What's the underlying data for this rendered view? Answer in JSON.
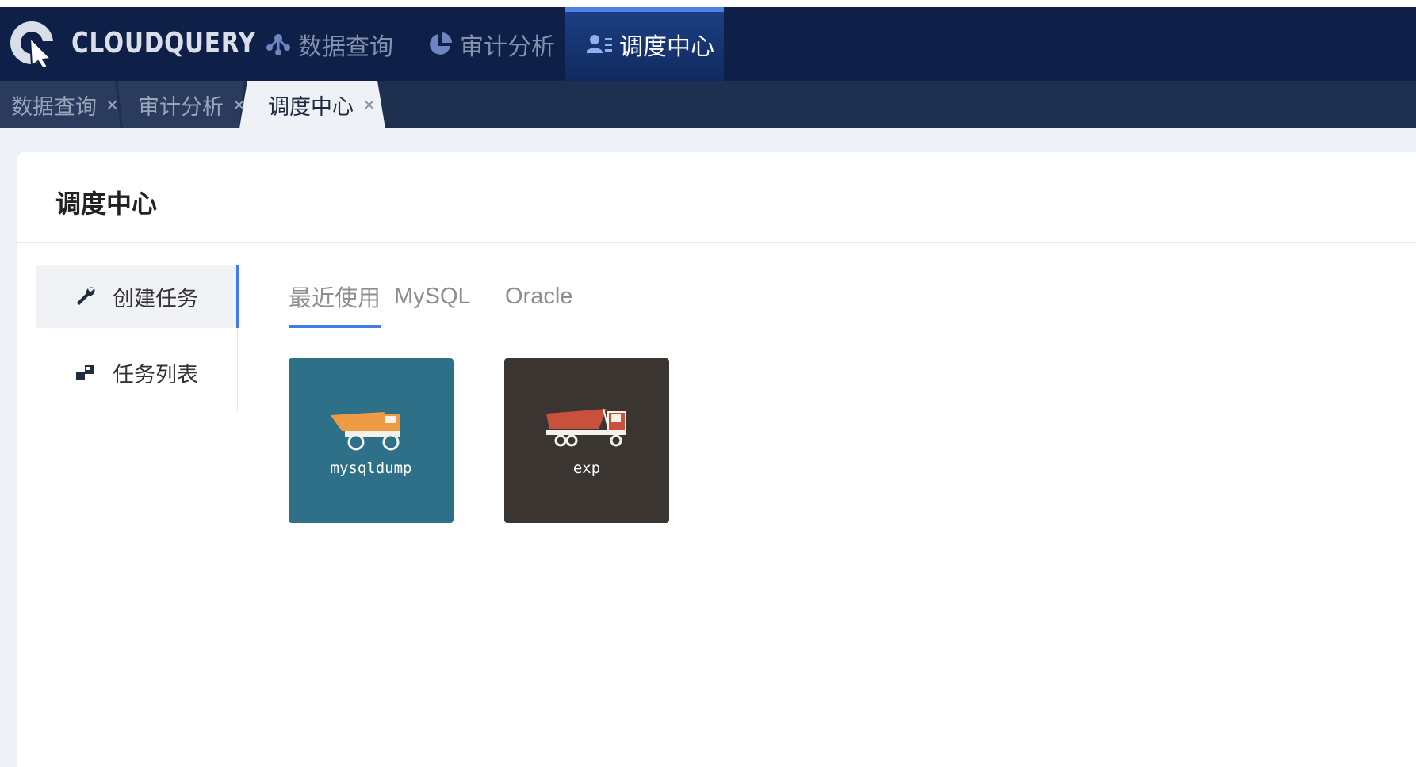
{
  "app": {
    "brand": "CLOUDQUERY"
  },
  "nav": {
    "items": [
      {
        "label": "数据查询",
        "icon": "share-nodes-icon"
      },
      {
        "label": "审计分析",
        "icon": "pie-chart-icon"
      },
      {
        "label": "调度中心",
        "icon": "user-list-icon",
        "active": true
      }
    ]
  },
  "tabs": [
    {
      "label": "数据查询",
      "close": "×"
    },
    {
      "label": "审计分析",
      "close": "×"
    },
    {
      "label": "调度中心",
      "close": "×",
      "active": true
    }
  ],
  "page": {
    "title": "调度中心",
    "sidebar": [
      {
        "label": "创建任务",
        "icon": "wrench-icon",
        "active": true
      },
      {
        "label": "任务列表",
        "icon": "blocks-icon"
      }
    ],
    "tool_tabs": [
      {
        "label": "最近使用",
        "active": true
      },
      {
        "label": "MySQL"
      },
      {
        "label": "Oracle"
      }
    ],
    "cards": [
      {
        "label": "mysqldump",
        "icon": "dump-truck-icon",
        "bg": "#2f7089",
        "truck_color": "#ef9a45"
      },
      {
        "label": "exp",
        "icon": "dump-truck-icon",
        "bg": "#3a3531",
        "truck_color": "#c9503c"
      }
    ]
  },
  "colors": {
    "navbar": "#0e1f48",
    "accent": "#3f7ee8",
    "tabbar": "#1e2f50"
  }
}
